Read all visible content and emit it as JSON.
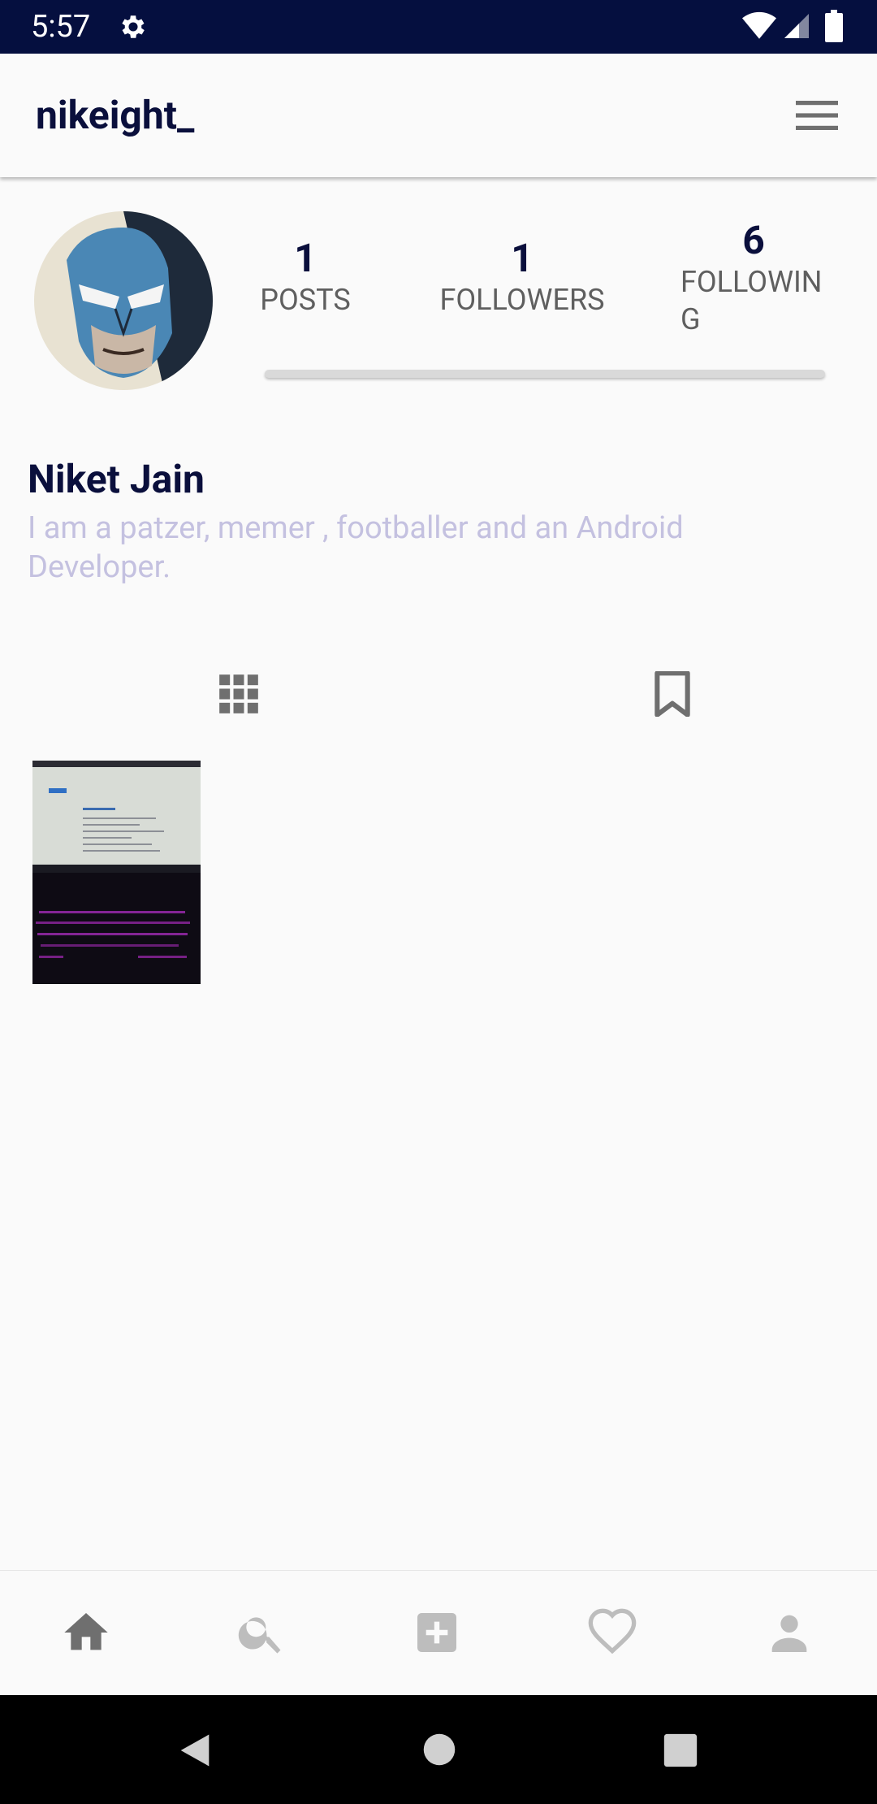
{
  "status_bar": {
    "time": "5:57"
  },
  "app_bar": {
    "username": "nikeight_"
  },
  "profile": {
    "stats": {
      "posts": {
        "count": "1",
        "label": "POSTS"
      },
      "followers": {
        "count": "1",
        "label": "FOLLOWERS"
      },
      "following": {
        "count": "6",
        "label": "FOLLOWING"
      }
    },
    "full_name": "Niket Jain",
    "bio": "I am a patzer, memer , footballer and an Android Developer."
  },
  "tabs": [
    {
      "icon": "grid-icon"
    },
    {
      "icon": "bookmark-icon"
    }
  ],
  "posts_count_visible": 1,
  "bottom_nav": [
    {
      "icon": "home-icon",
      "active": true
    },
    {
      "icon": "search-icon",
      "active": false
    },
    {
      "icon": "add-post-icon",
      "active": false
    },
    {
      "icon": "heart-icon",
      "active": false
    },
    {
      "icon": "person-icon",
      "active": false
    }
  ],
  "colors": {
    "status_bar": "#050f3f",
    "primary_text": "#0a0f3c",
    "bio_text": "#c4c1e0",
    "background": "#fafafa"
  }
}
